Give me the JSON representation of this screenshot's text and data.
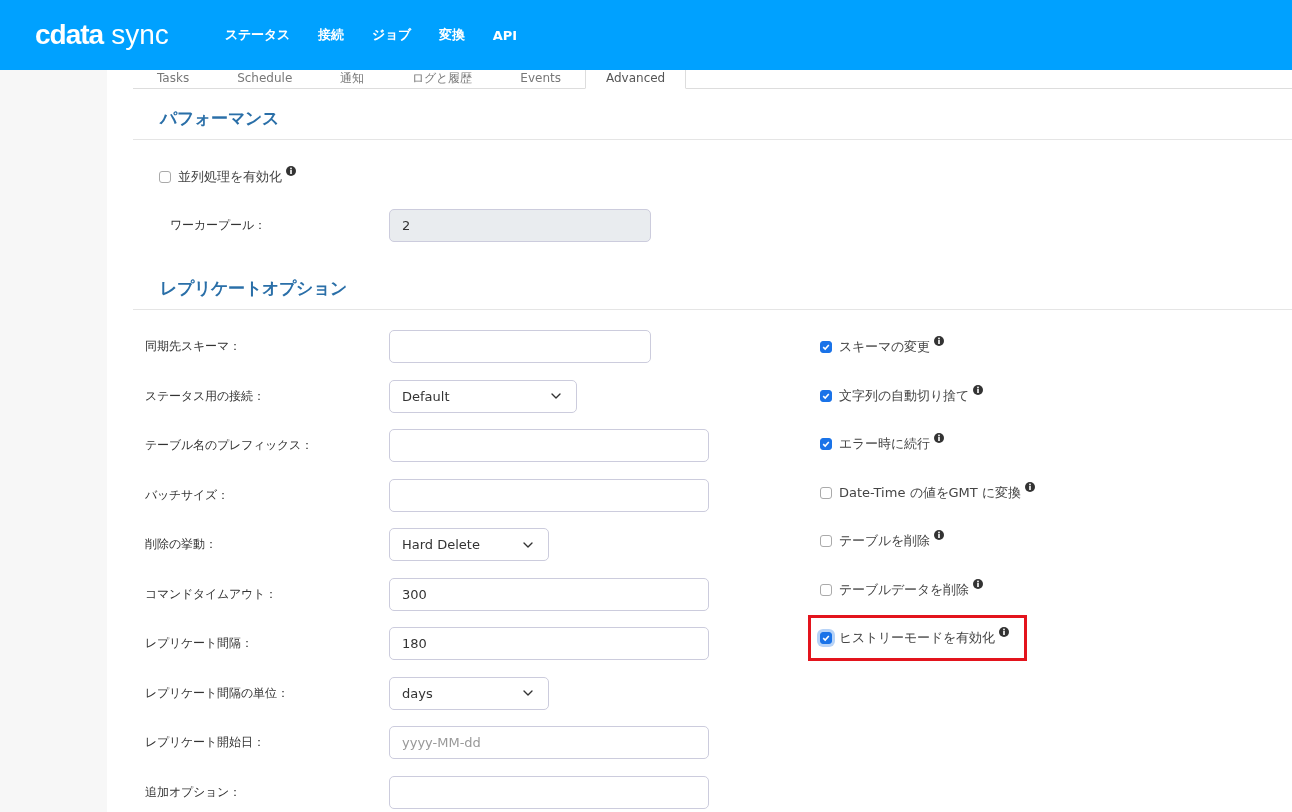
{
  "header": {
    "logo": {
      "brand": "cdata",
      "product": "sync"
    },
    "nav": [
      "ステータス",
      "接続",
      "ジョブ",
      "変換",
      "API"
    ]
  },
  "tabs": [
    {
      "label": "Tasks",
      "selected": false
    },
    {
      "label": "Schedule",
      "selected": false
    },
    {
      "label": "通知",
      "selected": false
    },
    {
      "label": "ログと履歴",
      "selected": false
    },
    {
      "label": "Events",
      "selected": false
    },
    {
      "label": "Advanced",
      "selected": true
    }
  ],
  "performance": {
    "title": "パフォーマンス",
    "parallel": {
      "label": "並列処理を有効化",
      "checked": false
    },
    "worker_pool": {
      "label": "ワーカープール：",
      "value": "2",
      "disabled": true
    }
  },
  "replicate": {
    "title": "レプリケートオプション",
    "fields": [
      {
        "kind": "text",
        "label": "同期先スキーマ："
      },
      {
        "kind": "select",
        "label": "ステータス用の接続：",
        "value": "Default"
      },
      {
        "kind": "text",
        "label": "テーブル名のプレフィックス："
      },
      {
        "kind": "text",
        "label": "バッチサイズ："
      },
      {
        "kind": "select",
        "label": "削除の挙動：",
        "value": "Hard Delete"
      },
      {
        "kind": "text",
        "label": "コマンドタイムアウト：",
        "value": "300"
      },
      {
        "kind": "text",
        "label": "レプリケート間隔：",
        "value": "180"
      },
      {
        "kind": "select",
        "label": "レプリケート間隔の単位：",
        "value": "days"
      },
      {
        "kind": "text",
        "label": "レプリケート開始日：",
        "placeholder": "yyyy-MM-dd"
      },
      {
        "kind": "text",
        "label": "追加オプション："
      }
    ],
    "options": [
      {
        "label": "スキーマの変更",
        "checked": true,
        "highlighted": false
      },
      {
        "label": "文字列の自動切り捨て",
        "checked": true,
        "highlighted": false
      },
      {
        "label": "エラー時に続行",
        "checked": true,
        "highlighted": false
      },
      {
        "label": "Date-Time の値をGMT に変換",
        "checked": false,
        "highlighted": false
      },
      {
        "label": "テーブルを削除",
        "checked": false,
        "highlighted": false
      },
      {
        "label": "テーブルデータを削除",
        "checked": false,
        "highlighted": false
      },
      {
        "label": "ヒストリーモードを有効化",
        "checked": true,
        "highlighted": true
      }
    ]
  }
}
